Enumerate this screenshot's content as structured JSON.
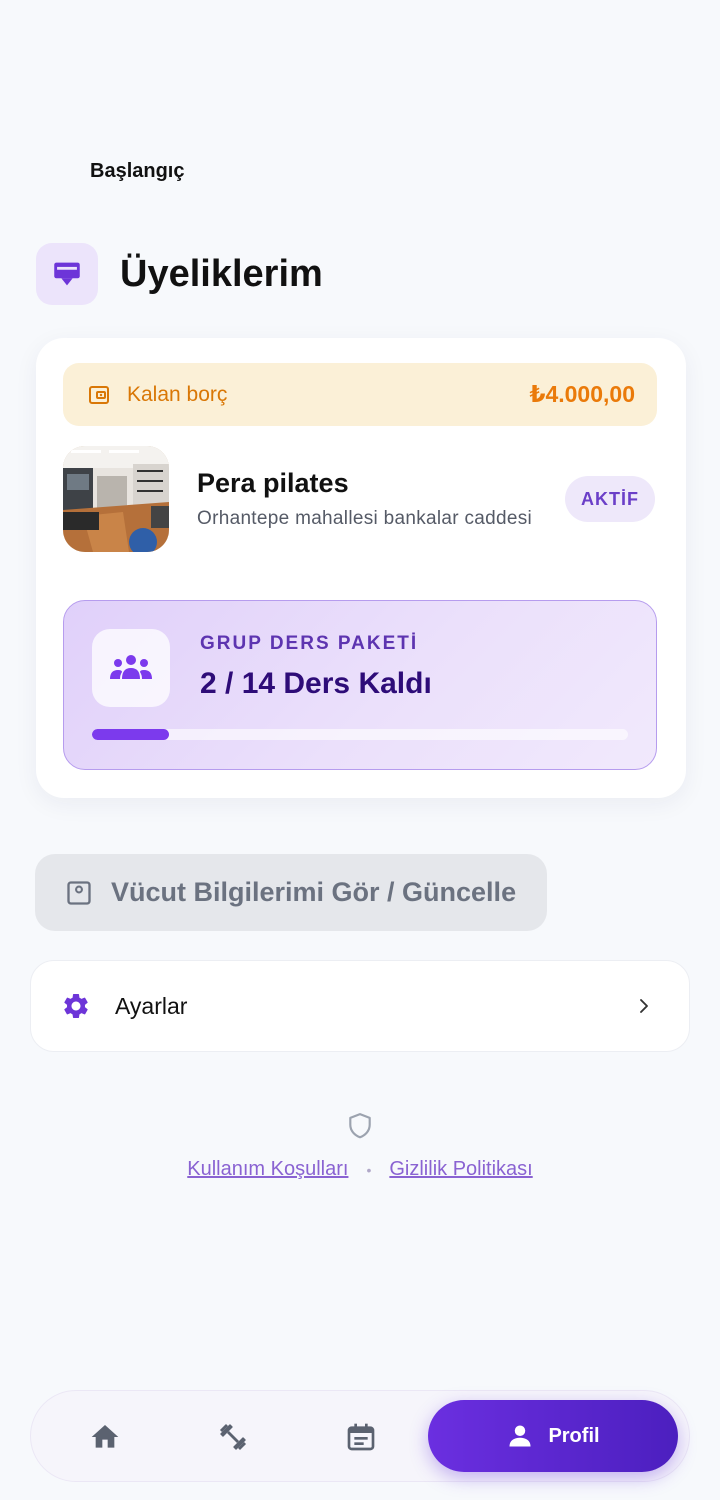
{
  "header": {
    "back_label": "Başlangıç",
    "title": "Üyeliklerim"
  },
  "membership": {
    "debt": {
      "label": "Kalan borç",
      "amount": "₺4.000,00"
    },
    "studio": {
      "name": "Pera pilates",
      "address": "Orhantepe mahallesi bankalar caddesi",
      "status": "AKTİF"
    },
    "package": {
      "label": "GRUP DERS PAKETİ",
      "remaining_text": "2 / 14 Ders Kaldı",
      "used": 2,
      "total": 14
    }
  },
  "body_info": {
    "label": "Vücut Bilgilerimi Gör / Güncelle"
  },
  "settings": {
    "label": "Ayarlar"
  },
  "legal": {
    "terms": "Kullanım Koşulları",
    "privacy": "Gizlilik Politikası"
  },
  "bottom_nav": {
    "items": [
      {
        "icon": "home-icon"
      },
      {
        "icon": "dumbbell-icon"
      },
      {
        "icon": "calendar-icon"
      },
      {
        "icon": "person-icon",
        "label": "Profil",
        "active": true
      }
    ]
  },
  "colors": {
    "accent": "#6b2fe0",
    "warning": "#ea7a0a",
    "package_bg": "#e6d9fb"
  }
}
